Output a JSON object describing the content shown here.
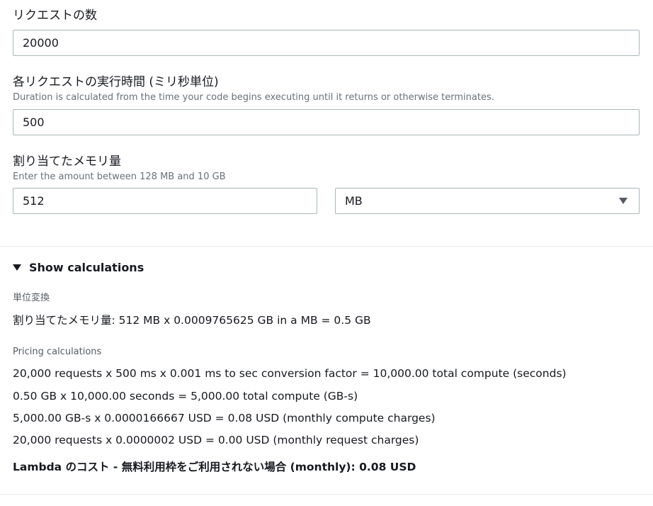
{
  "requests": {
    "label": "リクエストの数",
    "value": "20000"
  },
  "duration": {
    "label": "各リクエストの実行時間 (ミリ秒単位)",
    "description": "Duration is calculated from the time your code begins executing until it returns or otherwise terminates.",
    "value": "500"
  },
  "memory": {
    "label": "割り当てたメモリ量",
    "description": "Enter the amount between 128 MB and 10 GB",
    "value": "512",
    "unit_selected": "MB"
  },
  "calculations": {
    "toggle_label": "Show calculations",
    "expanded": true,
    "unit_conversion_title": "単位変換",
    "unit_conversion_line": "割り当てたメモリ量: 512 MB x 0.0009765625 GB in a MB = 0.5 GB",
    "pricing_title": "Pricing calculations",
    "pricing_lines": [
      "20,000 requests x 500 ms x 0.001 ms to sec conversion factor = 10,000.00 total compute (seconds)",
      "0.50 GB x 10,000.00 seconds = 5,000.00 total compute (GB-s)",
      "5,000.00 GB-s x 0.0000166667 USD = 0.08 USD (monthly compute charges)",
      "20,000 requests x 0.0000002 USD = 0.00 USD (monthly request charges)"
    ],
    "total_line": "Lambda のコスト - 無料利用枠をご利用されない場合 (monthly): 0.08 USD"
  },
  "icons": {
    "select_arrow": "caret-down-icon",
    "expander_caret": "caret-down-icon"
  },
  "colors": {
    "text": "#16191f",
    "secondary_text": "#687078",
    "input_border": "#aab7b8",
    "divider": "#eaeded"
  }
}
